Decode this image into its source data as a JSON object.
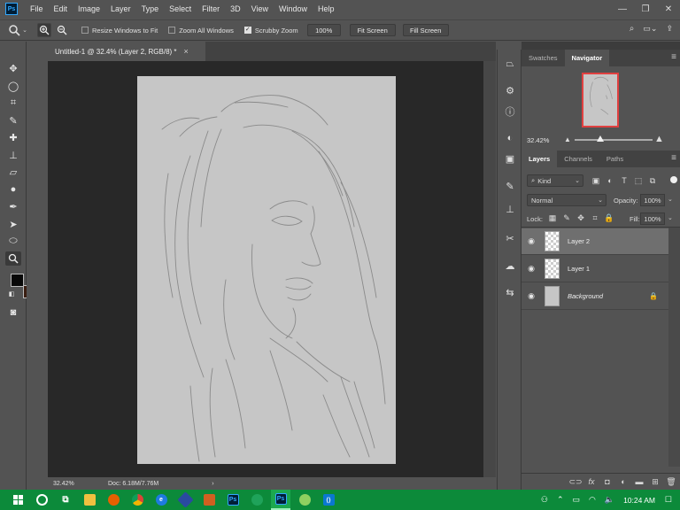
{
  "app": {
    "logo": "Ps",
    "menu": [
      "File",
      "Edit",
      "Image",
      "Layer",
      "Type",
      "Select",
      "Filter",
      "3D",
      "View",
      "Window",
      "Help"
    ],
    "window_controls": [
      "minimize-icon",
      "restore-icon",
      "close-icon"
    ]
  },
  "options_bar": {
    "tool_icon": "zoom-icon",
    "zoom_in_icon": "zoom-in-icon",
    "zoom_out_icon": "zoom-out-icon",
    "resize_windows": {
      "label": "Resize Windows to Fit",
      "checked": false
    },
    "zoom_all": {
      "label": "Zoom All Windows",
      "checked": false
    },
    "scrubby_zoom": {
      "label": "Scrubby Zoom",
      "checked": true
    },
    "zoom_value": "100%",
    "fit_screen": "Fit Screen",
    "fill_screen": "Fill Screen"
  },
  "document": {
    "tab_title": "Untitled-1 @ 32.4% (Layer 2, RGB/8) *",
    "close_glyph": "×",
    "canvas_color": "#c6c6c6"
  },
  "status": {
    "zoom": "32.42%",
    "doc_info": "Doc: 6.18M/7.76M",
    "arrow": "›"
  },
  "colors": {
    "foreground": "#080808",
    "background": "#3a1e12",
    "accent": "#31a8ff",
    "taskbar": "#0c8a3a"
  },
  "navigator": {
    "tabs": [
      "Swatches",
      "Navigator"
    ],
    "active_tab": "Navigator",
    "zoom": "32.42%",
    "slider_fraction": 0.33
  },
  "layers_panel": {
    "tabs": [
      "Layers",
      "Channels",
      "Paths"
    ],
    "active_tab": "Layers",
    "kind_label": "Kind",
    "blend_mode": "Normal",
    "opacity_label": "Opacity:",
    "opacity_value": "100%",
    "lock_label": "Lock:",
    "fill_label": "Fill:",
    "fill_value": "100%",
    "layers": [
      {
        "name": "Layer 2",
        "selected": true,
        "visible": true,
        "locked": false,
        "type": "transparent"
      },
      {
        "name": "Layer 1",
        "selected": false,
        "visible": true,
        "locked": false,
        "type": "transparent"
      },
      {
        "name": "Background",
        "selected": false,
        "visible": true,
        "locked": true,
        "type": "solid"
      }
    ]
  },
  "taskbar": {
    "clock": "10:24 AM",
    "apps": [
      "task-view",
      "file-explorer",
      "firefox",
      "chrome",
      "edge",
      "app-blue",
      "media-player",
      "photoshop-1",
      "app-globe",
      "photoshop-2",
      "app-wallpaper",
      "vscode"
    ]
  }
}
